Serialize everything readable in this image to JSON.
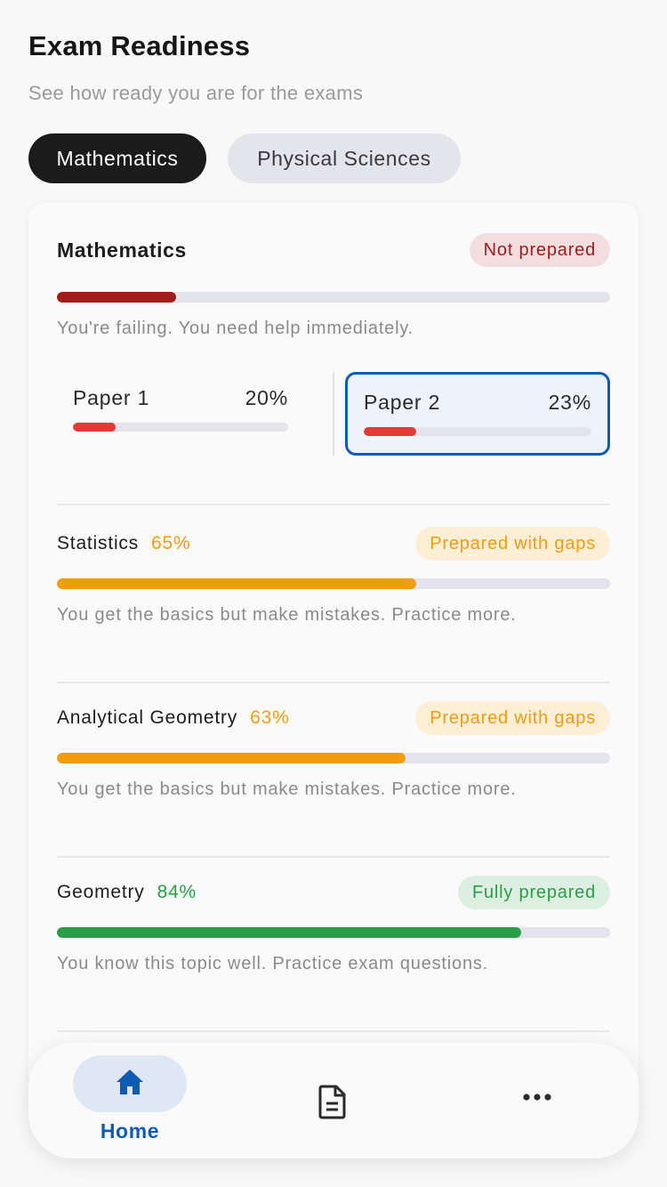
{
  "header": {
    "title": "Exam Readiness",
    "subtitle": "See how ready you are for the exams"
  },
  "tabs": [
    {
      "label": "Mathematics",
      "active": true
    },
    {
      "label": "Physical Sciences",
      "active": false
    }
  ],
  "colors": {
    "red": "#e53935",
    "dark_red": "#a11c1c",
    "orange": "#f29c0f",
    "green": "#2a9d46",
    "blue": "#0d5bb5"
  },
  "main_topic": {
    "name": "Mathematics",
    "badge": "Not prepared",
    "progress": 0.215,
    "note": "You're failing. You need help immediately.",
    "papers": [
      {
        "label": "Paper 1",
        "percent": "20%",
        "progress": 0.2,
        "selected": false
      },
      {
        "label": "Paper 2",
        "percent": "23%",
        "progress": 0.23,
        "selected": true
      }
    ]
  },
  "topics": [
    {
      "name": "Statistics",
      "percent": "65%",
      "progress": 0.65,
      "badge": "Prepared with gaps",
      "status": "gaps",
      "note": "You get the basics but make mistakes. Practice more."
    },
    {
      "name": "Analytical Geometry",
      "percent": "63%",
      "progress": 0.63,
      "badge": "Prepared with gaps",
      "status": "gaps",
      "note": "You get the basics but make mistakes. Practice more."
    },
    {
      "name": "Geometry",
      "percent": "84%",
      "progress": 0.84,
      "badge": "Fully prepared",
      "status": "full",
      "note": "You know this topic well. Practice exam questions."
    }
  ],
  "nav": {
    "home_label": "Home",
    "icons": [
      "home-icon",
      "document-icon",
      "more-icon"
    ]
  }
}
